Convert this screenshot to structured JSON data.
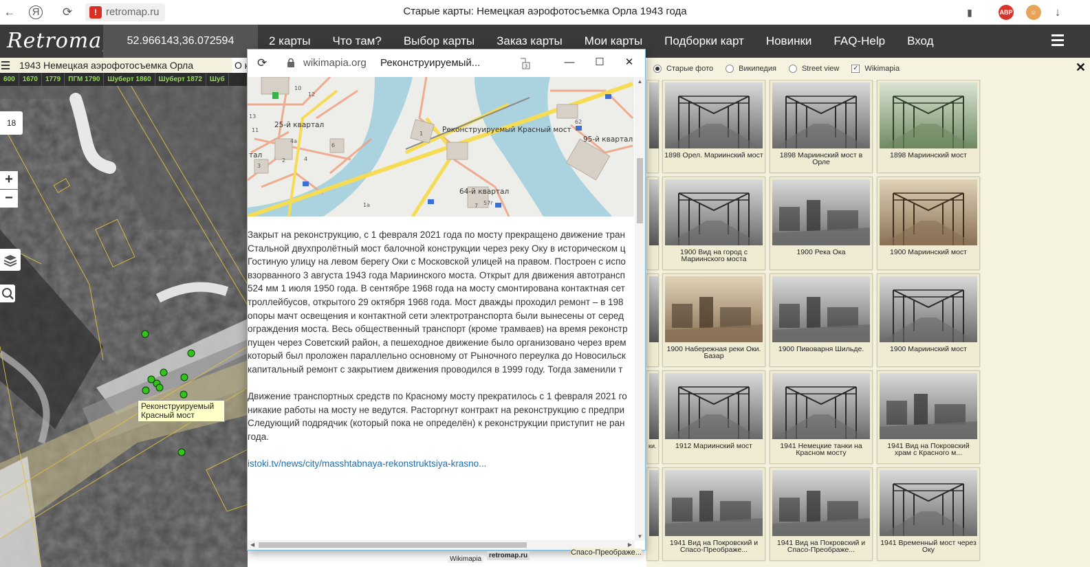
{
  "browser": {
    "back_icon": "back-arrow-icon",
    "yandex_label": "Я",
    "reload_icon": "reload-icon",
    "address": "retromap.ru",
    "page_title": "Старые карты: Немецкая аэрофотосъемка Орла 1943 года",
    "adblock_label": "ABP"
  },
  "site": {
    "logo": "Retromap",
    "coordinates": "52.966143,36.072594",
    "menu": [
      "2 карты",
      "Что там?",
      "Выбор карты",
      "Заказ карты",
      "Мои карты",
      "Подборки карт",
      "Новинки",
      "FAQ-Help",
      "Вход"
    ]
  },
  "map": {
    "title": "1943 Немецкая аэрофотосъемка Орла",
    "title_extra": "О к",
    "years": [
      "600",
      "1670",
      "1779",
      "ПГМ 1790",
      "Шуберт 1860",
      "Шуберт 1872",
      "Шуб"
    ],
    "zoom_level": "18",
    "zoom_in": "+",
    "zoom_out": "−",
    "tooltip": "Реконструируемый Красный мост",
    "attribution": "Wikimapia"
  },
  "popup": {
    "host": "wikimapia.org",
    "title": "Реконструируемый...",
    "tab_count": "3",
    "map_labels": {
      "q25": "25-й квартал",
      "bridge": "Реконструируемый Красный мост",
      "q95": "95-й квартал",
      "q64": "64-й квартал",
      "tal": "тал",
      "n1": "1",
      "n10": "10",
      "n12": "12",
      "n13": "13",
      "n11": "11",
      "n4a": "4а",
      "n6": "6",
      "n2": "2",
      "n3": "3",
      "n4": "4",
      "n62": "62",
      "n7": "7",
      "n57": "57г",
      "n1a": "1а"
    },
    "paragraphs": [
      [
        "Закрыт на реконструкцию, с 1 февраля 2021 года по мосту прекращено движение тран",
        "Стальной двухпролётный мост балочной конструкции через реку Оку в историческом ц",
        "Гостиную улицу на левом берегу Оки с Московской улицей на правом. Построен с испо",
        "взорванного 3 августа 1943 года Мариинского моста. Открыт для движения автотрансп",
        "524 мм 1 июля 1950 года. В сентябре 1968 года на мосту смонтирована контактная сет",
        "троллейбусов, открытого 29 октября 1968 года. Мост дважды проходил ремонт – в 198",
        "опоры мачт освещения и контактной сети электротранспорта были вынесены от серед",
        "ограждения моста. Весь общественный транспорт (кроме трамваев) на время реконстр",
        "пущен через Советский район, а пешеходное движение было организовано через врем",
        "который был проложен параллельно основному от Рыночного переулка до Новосильск",
        "капитальный ремонт с закрытием движения проводился в 1999 году. Тогда заменили т"
      ],
      [
        "Движение транспортных средств по Красному мосту прекратилось с 1 февраля 2021 го",
        "никакие работы на мосту не ведутся. Расторгнут контракт на реконструкцию с предпри",
        "Следующий подрядчик (который пока не определён) к реконструкции приступит не ран",
        "года."
      ]
    ],
    "link": "istoki.tv/news/city/masshtabnaya-rekonstruktsiya-krasno..."
  },
  "panel": {
    "options": [
      {
        "label": "Старые фото",
        "type": "radio",
        "checked": true
      },
      {
        "label": "Википедия",
        "type": "radio",
        "checked": false
      },
      {
        "label": "Street view",
        "type": "radio",
        "checked": false
      },
      {
        "label": "Wikimapia",
        "type": "checkbox",
        "checked": true
      }
    ],
    "close": "✕",
    "thumbs": [
      {
        "caption": "1898 Орел. Мариинский мост",
        "tone": "gray"
      },
      {
        "caption": "1898 Мариинский мост в Орле",
        "tone": "gray"
      },
      {
        "caption": "1898 Мариинский мост",
        "tone": "green"
      },
      {
        "caption": "1900 Вид на город с Мариинского моста",
        "tone": "gray"
      },
      {
        "caption": "1900 Река Ока",
        "tone": "gray"
      },
      {
        "caption": "1900 Мариинский мост",
        "tone": "sepia"
      },
      {
        "caption": "1900 Набережная реки Оки. Базар",
        "tone": "sepia"
      },
      {
        "caption": "1900 Пивоварня Шильде.",
        "tone": "gray"
      },
      {
        "caption": "1900 Мариинский мост",
        "tone": "gray"
      },
      {
        "caption": "1912 Мариинский мост",
        "tone": "gray"
      },
      {
        "caption": "1941 Немецкие танки на Красном мосту",
        "tone": "gray"
      },
      {
        "caption": "1941 Вид на Покровский храм с Красного м...",
        "tone": "gray"
      },
      {
        "caption": "1941 Вид на Покровский и Спасо-Преображе...",
        "tone": "gray"
      },
      {
        "caption": "1941 Вид на Покровский и Спасо-Преображе...",
        "tone": "gray"
      },
      {
        "caption": "1941 Временный мост через Оку",
        "tone": "gray"
      }
    ],
    "cut_caption_partial": "ки.",
    "bottom_partial": "Спасо-Преображе...",
    "attr_partial": "retromap.ru"
  }
}
